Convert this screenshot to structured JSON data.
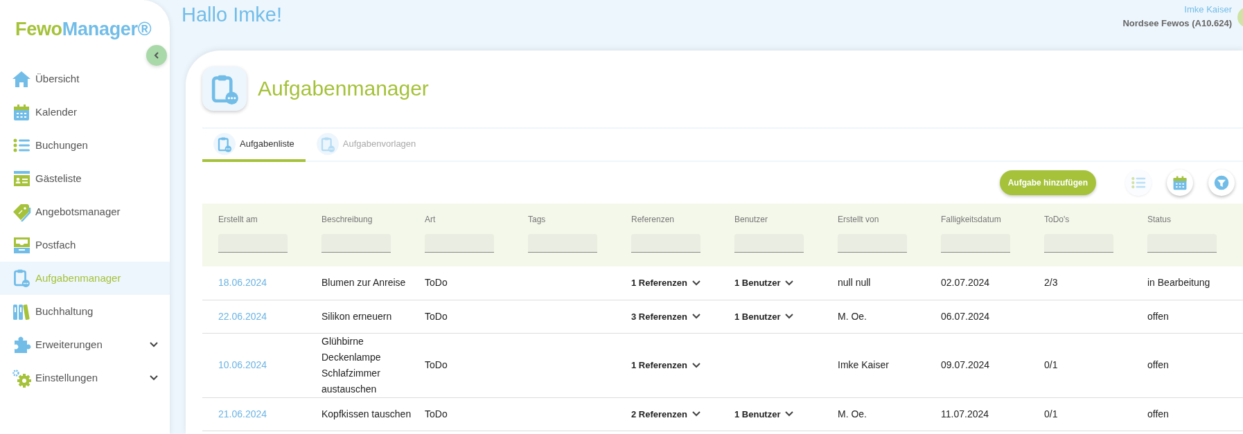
{
  "sidebar": {
    "logo": {
      "first": "Fewo",
      "second": "Manager®"
    },
    "items": [
      {
        "label": "Übersicht",
        "selected": false,
        "has_submenu": false
      },
      {
        "label": "Kalender",
        "selected": false,
        "has_submenu": false
      },
      {
        "label": "Buchungen",
        "selected": false,
        "has_submenu": false
      },
      {
        "label": "Gästeliste",
        "selected": false,
        "has_submenu": false
      },
      {
        "label": "Angebotsmanager",
        "selected": false,
        "has_submenu": false
      },
      {
        "label": "Postfach",
        "selected": false,
        "has_submenu": false
      },
      {
        "label": "Aufgabenmanager",
        "selected": true,
        "has_submenu": false
      },
      {
        "label": "Buchhaltung",
        "selected": false,
        "has_submenu": false
      },
      {
        "label": "Erweiterungen",
        "selected": false,
        "has_submenu": true
      },
      {
        "label": "Einstellungen",
        "selected": false,
        "has_submenu": true
      }
    ]
  },
  "header": {
    "greeting": "Hallo Imke!",
    "user_name": "Imke Kaiser",
    "account": "Nordsee Fewos (A10.624)"
  },
  "page": {
    "title": "Aufgabenmanager",
    "tabs": [
      {
        "label": "Aufgabenliste",
        "selected": true
      },
      {
        "label": "Aufgabenvorlagen",
        "selected": false
      }
    ],
    "add_button": "Aufgabe hinzufügen",
    "view_buttons": [
      {
        "active": false
      },
      {
        "active": true
      },
      {
        "active": true
      }
    ]
  },
  "table": {
    "columns": [
      "Erstellt am",
      "Beschreibung",
      "Art",
      "Tags",
      "Referenzen",
      "Benutzer",
      "Erstellt von",
      "Falligkeitsdatum",
      "ToDo's",
      "Status"
    ],
    "rows": [
      {
        "created": "18.06.2024",
        "description": "Blumen zur Anreise",
        "type": "ToDo",
        "references": "1 Referenzen",
        "users": "1 Benutzer",
        "created_by": "null null",
        "due": "02.07.2024",
        "todos": "2/3",
        "status": "in Bearbeitung"
      },
      {
        "created": "22.06.2024",
        "description": "Silikon erneuern",
        "type": "ToDo",
        "references": "3 Referenzen",
        "users": "1 Benutzer",
        "created_by": "M. Oe.",
        "due": "06.07.2024",
        "status": "offen"
      },
      {
        "created": "10.06.2024",
        "description": "Glühbirne Deckenlampe Schlafzimmer austauschen",
        "type": "ToDo",
        "references": "1 Referenzen",
        "created_by": "Imke Kaiser",
        "due": "09.07.2024",
        "todos": "0/1",
        "status": "offen"
      },
      {
        "created": "21.06.2024",
        "description": "Kopfkissen tauschen",
        "type": "ToDo",
        "references": "2 Referenzen",
        "users": "1 Benutzer",
        "created_by": "M. Oe.",
        "due": "11.07.2024",
        "todos": "0/1",
        "status": "offen"
      }
    ]
  }
}
